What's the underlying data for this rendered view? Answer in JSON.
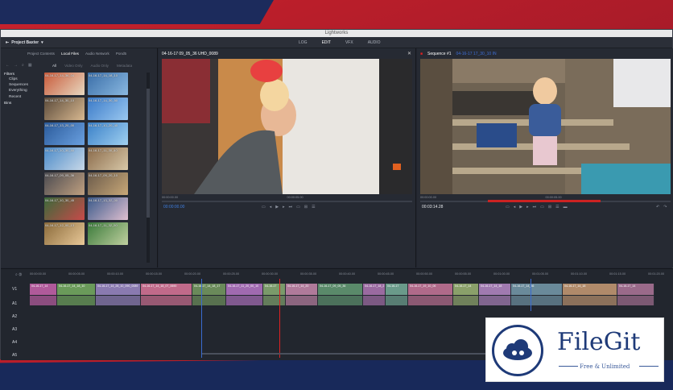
{
  "window": {
    "title": "Lightworks"
  },
  "menubar": {
    "project": "Project Baxter",
    "tabs": [
      "LOG",
      "EDIT",
      "VFX",
      "AUDIO"
    ],
    "active_tab": "EDIT"
  },
  "library": {
    "tabs": [
      "Project Contents",
      "Local Files",
      "Audio Network",
      "Pond5"
    ],
    "active_tab": "Local Files",
    "subtabs": [
      "All",
      "Video Only",
      "Audio Only",
      "Metadata"
    ],
    "filters": {
      "heading": "Filters",
      "items": [
        "Clips",
        "Sequences",
        "Everything",
        "Recent"
      ],
      "bins": "Bins"
    },
    "clips": [
      "04-16-17_14_36_04",
      "04-16-17_14_18_10",
      "04-16-17_14_30_10",
      "04-16-17_14_30_50",
      "04-16-17_13_20_00",
      "04-16-17_10_20_40",
      "04-16-17_10_30_50",
      "04-16-17_11_30_40",
      "04-16-17_09_05_36",
      "04-16-17_09_20_10",
      "04-16-17_10_30_45",
      "04-16-17_13_32_00",
      "04-16-17_12_00_13",
      "04-16-17_11_32_50"
    ]
  },
  "viewer_source": {
    "title": "04-16-17 09_05_36 UHD_0089",
    "tc_start": "00:00:00.00",
    "tc_end": "00:00:05.00",
    "tc_current": "00:00:00.00"
  },
  "viewer_record": {
    "title": "Sequence #1",
    "subtitle": "04-16-17 17_30_10 IN",
    "tc_start": "00:00:00.00",
    "tc_end": "00:00:05.00",
    "tc_current": "00:03:14.28"
  },
  "timeline": {
    "ruler": [
      "00:00:00.00",
      "00:00:05.00",
      "00:00:10.00",
      "00:00:15.00",
      "00:00:20.00",
      "00:00:25.00",
      "00:00:30.00",
      "00:00:35.00",
      "00:00:40.00",
      "00:00:45.00",
      "00:00:50.00",
      "00:00:55.00",
      "00:01:00.00",
      "00:01:05.00",
      "00:01:10.00",
      "00:01:15.00",
      "00:01:20.00"
    ],
    "tracks": [
      "V1",
      "A1",
      "A2",
      "A3",
      "A4",
      "A5"
    ],
    "v1_clips": [
      "04-16-17_14",
      "04-16-17_14_18_10",
      "04-16-17_14_28_10_090_0089",
      "04-16-17_14_18_07_0690",
      "04-16-17_14_18_17",
      "04-16-17_11_20_00_10",
      "04-16-17",
      "04-16-17_14_20",
      "04-16-17_09_05_36",
      "04-16-17_18_2",
      "04-16-17",
      "04-16-17_19_10_06",
      "04-16-17_14",
      "04-16-17_14_18",
      "04-16-17_14_36",
      "04-16-17_14_18",
      "04-16-17_14"
    ]
  },
  "logo": {
    "name": "FileGit",
    "tagline": "Free & Unlimited"
  }
}
